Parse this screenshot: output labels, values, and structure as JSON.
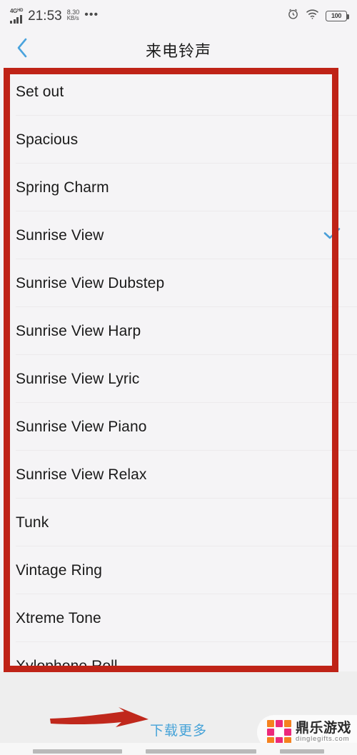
{
  "statusbar": {
    "network_type": "4G",
    "network_badge": "HD",
    "time": "21:53",
    "speed_value": "8.30",
    "speed_unit": "KB/s",
    "overflow": "•••",
    "alarm_icon": "alarm-clock-icon",
    "wifi_icon": "wifi-icon",
    "battery_level": "100"
  },
  "header": {
    "back_icon": "chevron-left-icon",
    "title": "来电铃声"
  },
  "ringtones": {
    "selected": "Sunrise View",
    "check_color": "#4a9fd8",
    "items": [
      {
        "label": "Set out",
        "selected": false
      },
      {
        "label": "Spacious",
        "selected": false
      },
      {
        "label": "Spring Charm",
        "selected": false
      },
      {
        "label": "Sunrise View",
        "selected": true
      },
      {
        "label": "Sunrise View Dubstep",
        "selected": false
      },
      {
        "label": "Sunrise View Harp",
        "selected": false
      },
      {
        "label": "Sunrise View Lyric",
        "selected": false
      },
      {
        "label": "Sunrise View Piano",
        "selected": false
      },
      {
        "label": "Sunrise View Relax",
        "selected": false
      },
      {
        "label": "Tunk",
        "selected": false
      },
      {
        "label": "Vintage Ring",
        "selected": false
      },
      {
        "label": "Xtreme Tone",
        "selected": false
      },
      {
        "label": "Xylophone Roll",
        "selected": false
      }
    ]
  },
  "footer": {
    "download_more": "下载更多",
    "link_color": "#46a3d8"
  },
  "watermark": {
    "brand_cn": "鼎乐游戏",
    "url": "dinglegifts.com",
    "color_orange": "#F5821F",
    "color_pink": "#EC297B"
  },
  "annotations": {
    "highlight_color": "#bf2317",
    "box_target": "ringtone-list",
    "arrow_target": "download-more-link"
  }
}
